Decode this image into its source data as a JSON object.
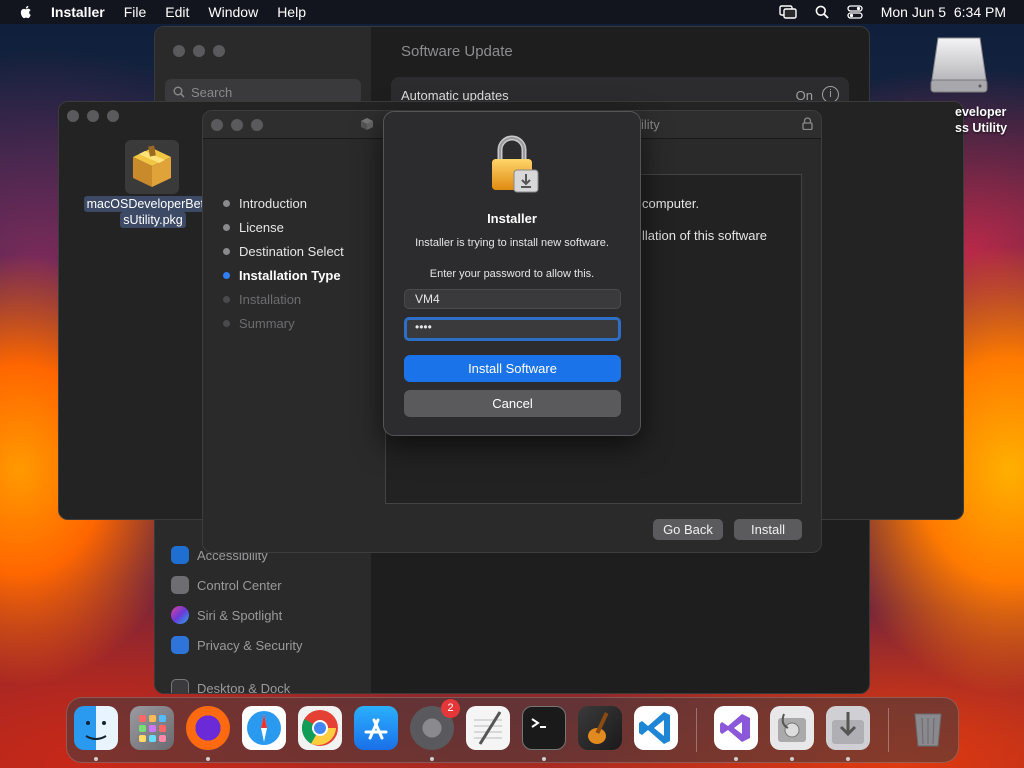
{
  "menubar": {
    "app": "Installer",
    "items": [
      "File",
      "Edit",
      "Window",
      "Help"
    ],
    "datetime": "Mon Jun 5  6:34 PM"
  },
  "settings": {
    "title": "Software Update",
    "search_placeholder": "Search",
    "auto_updates_label": "Automatic updates",
    "auto_updates_value": "On",
    "sidebar": [
      "Accessibility",
      "Control Center",
      "Siri & Spotlight",
      "Privacy & Security",
      "Desktop & Dock"
    ]
  },
  "finder": {
    "file_line1": "macOSDeveloperBetaA",
    "file_line2": "sUtility.pkg"
  },
  "installer": {
    "title_fragment": "ility",
    "steps": [
      "Introduction",
      "License",
      "Destination Select",
      "Installation Type",
      "Installation",
      "Summary"
    ],
    "content_line1": "computer.",
    "content_line2": "llation of this software",
    "go_back": "Go Back",
    "install": "Install"
  },
  "auth": {
    "title": "Installer",
    "subtitle": "Installer is trying to install new software.",
    "prompt": "Enter your password to allow this.",
    "username": "VM4",
    "password": "••••",
    "primary": "Install Software",
    "cancel": "Cancel"
  },
  "desktop": {
    "disk_label": "eveloper\nss Utility"
  },
  "dock": {
    "settings_badge": "2"
  },
  "colors": {
    "accent": "#1a73e8",
    "current_step": "#2f7ff7"
  }
}
